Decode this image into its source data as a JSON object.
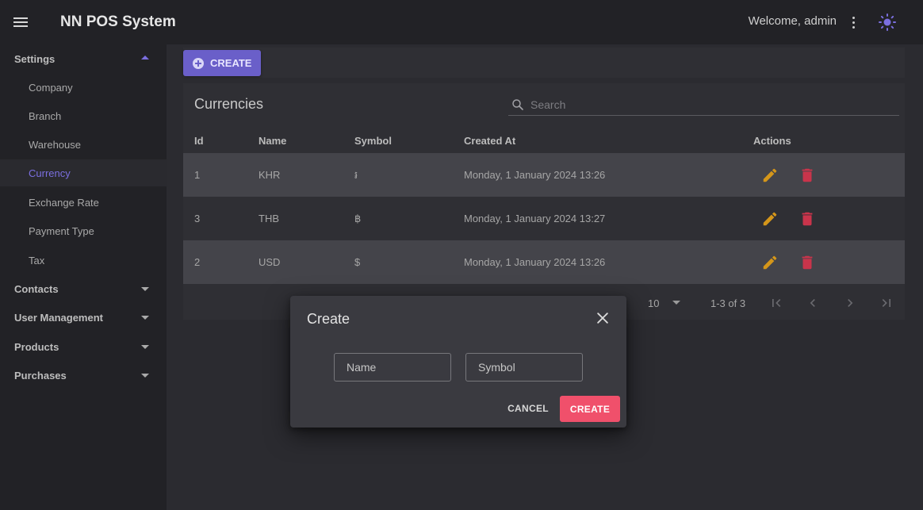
{
  "header": {
    "title": "NN POS System",
    "welcome": "Welcome, admin",
    "accent_color": "#7b6fe0"
  },
  "sidebar": {
    "groups": [
      {
        "label": "Settings",
        "expanded": true
      },
      {
        "label": "Contacts",
        "expanded": false
      },
      {
        "label": "User Management",
        "expanded": false
      },
      {
        "label": "Products",
        "expanded": false
      },
      {
        "label": "Purchases",
        "expanded": false
      }
    ],
    "settings_items": [
      {
        "label": "Company"
      },
      {
        "label": "Branch"
      },
      {
        "label": "Warehouse"
      },
      {
        "label": "Currency",
        "active": true
      },
      {
        "label": "Exchange Rate"
      },
      {
        "label": "Payment Type"
      },
      {
        "label": "Tax"
      }
    ]
  },
  "toolbar": {
    "create_label": "CREATE",
    "create_color": "#6a5fc9"
  },
  "table": {
    "title": "Currencies",
    "search_placeholder": "Search",
    "columns": [
      "Id",
      "Name",
      "Symbol",
      "Created At",
      "Actions"
    ],
    "rows": [
      {
        "id": "1",
        "name": "KHR",
        "symbol": "៛",
        "created_at": "Monday, 1 January 2024 13:26"
      },
      {
        "id": "3",
        "name": "THB",
        "symbol": "฿",
        "created_at": "Monday, 1 January 2024 13:27"
      },
      {
        "id": "2",
        "name": "USD",
        "symbol": "$",
        "created_at": "Monday, 1 January 2024 13:26"
      }
    ],
    "rows_per_page": "10",
    "range": "1-3 of 3",
    "edit_color": "#d4961a",
    "delete_color": "#c9344b"
  },
  "dialog": {
    "title": "Create",
    "name_placeholder": "Name",
    "symbol_placeholder": "Symbol",
    "cancel_label": "CANCEL",
    "create_label": "CREATE",
    "create_color": "#f0506b"
  }
}
